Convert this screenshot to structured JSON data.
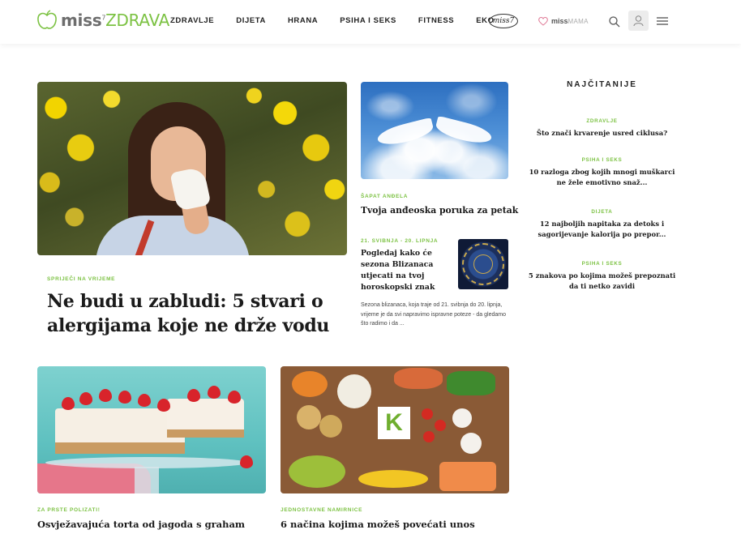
{
  "header": {
    "logo": {
      "miss": "miss",
      "sup": "7",
      "zdrava": "ZDRAVA"
    },
    "nav": [
      "ZDRAVLJE",
      "DIJETA",
      "HRANA",
      "PSIHA I SEKS",
      "FITNESS",
      "EKO"
    ],
    "miss7_badge": "miss7",
    "missmama": {
      "a": "miss",
      "b": "MAMA"
    },
    "icons": [
      "search-icon",
      "user-icon",
      "menu-icon"
    ]
  },
  "hero": {
    "category": "SPRIJEČI NA VRIJEME",
    "title": "Ne budi u zabludi: 5 stvari o alergijama koje ne drže vodu"
  },
  "angel": {
    "category": "ŠAPAT ANĐELA",
    "title": "Tvoja anđeoska poruka za petak"
  },
  "blizanci": {
    "category": "21. SVIBNJA - 20. LIPNJA",
    "title": "Pogledaj kako će sezona Blizanaca utjecati na tvoj horoskopski znak",
    "excerpt": "Sezona blizanaca, koja traje od 21. svibnja do 20. lipnja, vrijeme je da svi napravimo ispravne poteze - da gledamo što radimo i da ..."
  },
  "most_read": {
    "heading": "NAJČITANIJE",
    "items": [
      {
        "category": "ZDRAVLJE",
        "title": "Što znači krvarenje usred ciklusa?"
      },
      {
        "category": "PSIHA I SEKS",
        "title": "10 razloga zbog kojih mnogi muškarci ne žele emotivno snaž..."
      },
      {
        "category": "DIJETA",
        "title": "12 najboljih napitaka za detoks i sagorijevanje kalorija po prepor..."
      },
      {
        "category": "PSIHA I SEKS",
        "title": "5 znakova po kojima možeš prepoznati da ti netko zavidi"
      }
    ]
  },
  "bottom": [
    {
      "category": "ZA PRSTE POLIZATI!",
      "title": "Osvježavajuća torta od jagoda s graham"
    },
    {
      "category": "JEDNOSTAVNE NAMIRNICE",
      "title": "6 načina kojima možeš povećati unos",
      "badge_letter": "K"
    }
  ],
  "colors": {
    "accent": "#7cc243",
    "text": "#1b1b1b"
  }
}
